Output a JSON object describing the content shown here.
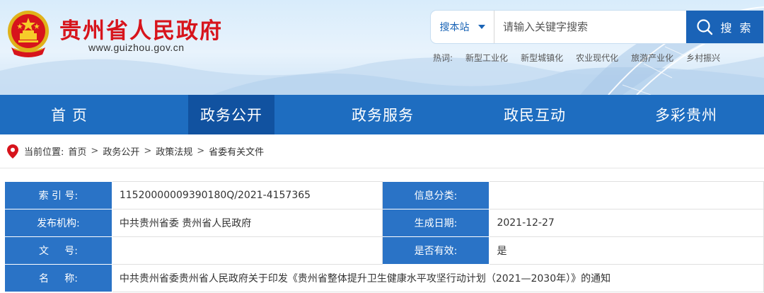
{
  "site": {
    "title": "贵州省人民政府",
    "url": "www.guizhou.gov.cn"
  },
  "search": {
    "scope_label": "搜本站",
    "placeholder": "请输入关键字搜索",
    "button_label": "搜 索"
  },
  "hotwords": {
    "label": "热词:",
    "items": [
      "新型工业化",
      "新型城镇化",
      "农业现代化",
      "旅游产业化",
      "乡村振兴"
    ]
  },
  "nav": {
    "items": [
      {
        "label": "首  页"
      },
      {
        "label": "政务公开"
      },
      {
        "label": "政务服务"
      },
      {
        "label": "政民互动"
      },
      {
        "label": "多彩贵州"
      }
    ],
    "active_index": 1
  },
  "breadcrumb": {
    "prefix": "当前位置:",
    "items": [
      "首页",
      "政务公开",
      "政策法规",
      "省委有关文件"
    ],
    "separator": ">"
  },
  "info": {
    "index_label": "索 引 号:",
    "index_value": "11520000009390180Q/2021-4157365",
    "category_label": "信息分类:",
    "category_value": "",
    "publisher_label": "发布机构:",
    "publisher_value": "中共贵州省委 贵州省人民政府",
    "date_label": "生成日期:",
    "date_value": "2021-12-27",
    "docno_label": "文     号:",
    "docno_value": "",
    "valid_label": "是否有效:",
    "valid_value": "是",
    "name_label": "名     称:",
    "name_value": "中共贵州省委贵州省人民政府关于印发《贵州省整体提升卫生健康水平攻坚行动计划（2021—2030年）》的通知"
  },
  "colors": {
    "title_red": "#d7141c",
    "nav_blue": "#1e6dc0",
    "nav_active": "#1152a0",
    "label_blue": "#2a73c6"
  }
}
